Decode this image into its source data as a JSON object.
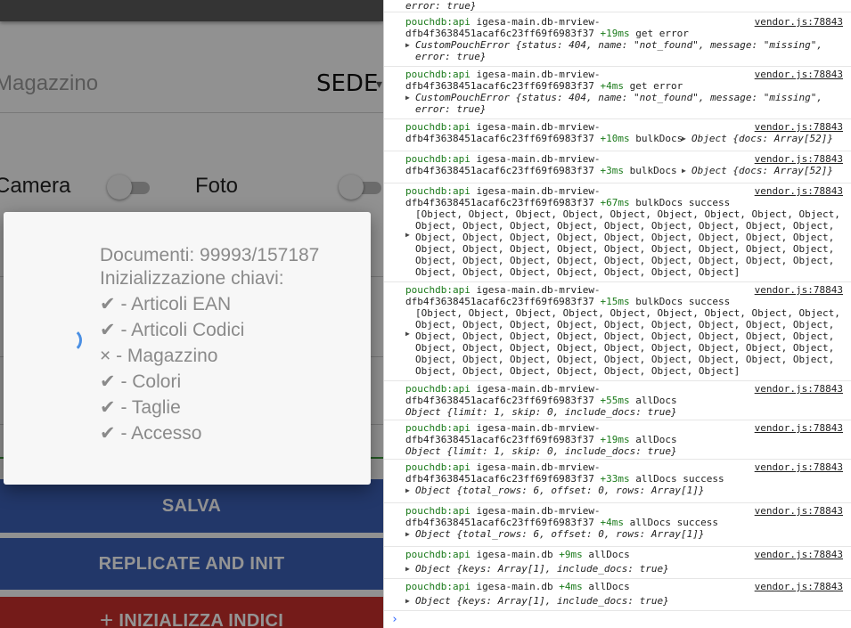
{
  "app": {
    "magazzino_label": "Magazzino",
    "sede_label": "SEDE",
    "camera_label": "Camera",
    "foto_label": "Foto",
    "buttons": {
      "salva": "SALVA",
      "replicate": "REPLICATE AND INIT",
      "init_indici": "INIZIALIZZA INDICI",
      "init_icon": "plus-icon"
    },
    "dialog": {
      "documents": "Documenti: 99993/157187",
      "title": "Inizializzazione chiavi:",
      "items": [
        {
          "mark": "✔",
          "text": " - Articoli EAN"
        },
        {
          "mark": "✔",
          "text": " - Articoli Codici"
        },
        {
          "mark": "×",
          "text": " - Magazzino"
        },
        {
          "mark": "✔",
          "text": " - Colori"
        },
        {
          "mark": "✔",
          "text": " - Taglie"
        },
        {
          "mark": "✔",
          "text": " - Accesso"
        }
      ]
    },
    "colors": {
      "primary_button": "#3b5fb6",
      "danger_button": "#c9302c",
      "spinner": "#4a8fe3"
    }
  },
  "console": {
    "source": "vendor.js:78843",
    "top_partial": "error: true}",
    "entries": [
      {
        "ns": "pouchdb:api",
        "db": "igesa-main.db-mrview-",
        "hash": "dfb4f3638451acaf6c23ff69f6983f37",
        "delta": "+19ms",
        "msg": "get error",
        "obj": "CustomPouchError {status: 404, name: \"not_found\", message: \"missing\",",
        "obj2": "error: true}"
      },
      {
        "ns": "pouchdb:api",
        "db": "igesa-main.db-mrview-",
        "hash": "dfb4f3638451acaf6c23ff69f6983f37",
        "delta": "+4ms",
        "msg": "get error",
        "obj": "CustomPouchError {status: 404, name: \"not_found\", message: \"missing\",",
        "obj2": "error: true}"
      },
      {
        "ns": "pouchdb:api",
        "db": "igesa-main.db-mrview-",
        "hash": "dfb4f3638451acaf6c23ff69f6983f37",
        "delta": "+10ms",
        "msg": "bulkDocs",
        "obj": "Object {docs: Array[52]}"
      },
      {
        "ns": "pouchdb:api",
        "db": "igesa-main.db-mrview-",
        "hash": "dfb4f3638451acaf6c23ff69f6983f37",
        "delta": "+3ms",
        "msg": "bulkDocs",
        "obj": "Object {docs: Array[52]}"
      },
      {
        "ns": "pouchdb:api",
        "db": "igesa-main.db-mrview-",
        "hash": "dfb4f3638451acaf6c23ff69f6983f37",
        "delta": "+67ms",
        "msg": "bulkDocs success",
        "arr": [
          "[Object, Object, Object, Object, Object, Object, Object, Object, Object,",
          "Object, Object, Object, Object, Object, Object, Object, Object, Object,",
          "Object, Object, Object, Object, Object, Object, Object, Object, Object,",
          "Object, Object, Object, Object, Object, Object, Object, Object, Object,",
          "Object, Object, Object, Object, Object, Object, Object, Object, Object,",
          "Object, Object, Object, Object, Object, Object, Object]"
        ]
      },
      {
        "ns": "pouchdb:api",
        "db": "igesa-main.db-mrview-",
        "hash": "dfb4f3638451acaf6c23ff69f6983f37",
        "delta": "+15ms",
        "msg": "bulkDocs success",
        "arr": [
          "[Object, Object, Object, Object, Object, Object, Object, Object, Object,",
          "Object, Object, Object, Object, Object, Object, Object, Object, Object,",
          "Object, Object, Object, Object, Object, Object, Object, Object, Object,",
          "Object, Object, Object, Object, Object, Object, Object, Object, Object,",
          "Object, Object, Object, Object, Object, Object, Object, Object, Object,",
          "Object, Object, Object, Object, Object, Object, Object]"
        ]
      },
      {
        "ns": "pouchdb:api",
        "db": "igesa-main.db-mrview-",
        "hash": "dfb4f3638451acaf6c23ff69f6983f37",
        "delta": "+55ms",
        "msg": "allDocs",
        "obj": "Object {limit: 1, skip: 0, include_docs: true}"
      },
      {
        "ns": "pouchdb:api",
        "db": "igesa-main.db-mrview-",
        "hash": "dfb4f3638451acaf6c23ff69f6983f37",
        "delta": "+19ms",
        "msg": "allDocs",
        "obj": "Object {limit: 1, skip: 0, include_docs: true}"
      },
      {
        "ns": "pouchdb:api",
        "db": "igesa-main.db-mrview-",
        "hash": "dfb4f3638451acaf6c23ff69f6983f37",
        "delta": "+33ms",
        "msg": "allDocs success",
        "obj": "Object {total_rows: 6, offset: 0, rows: Array[1]}"
      },
      {
        "ns": "pouchdb:api",
        "db": "igesa-main.db-mrview-",
        "hash": "dfb4f3638451acaf6c23ff69f6983f37",
        "delta": "+4ms",
        "msg": "allDocs success",
        "obj": "Object {total_rows: 6, offset: 0, rows: Array[1]}"
      },
      {
        "ns": "pouchdb:api",
        "db": "igesa-main.db",
        "hash": "",
        "delta": "+9ms",
        "msg": "allDocs",
        "obj": "Object {keys: Array[1], include_docs: true}"
      },
      {
        "ns": "pouchdb:api",
        "db": "igesa-main.db",
        "hash": "",
        "delta": "+4ms",
        "msg": "allDocs",
        "obj": "Object {keys: Array[1], include_docs: true}"
      }
    ]
  }
}
